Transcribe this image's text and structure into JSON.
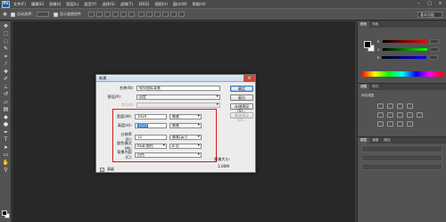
{
  "app": {
    "logo": "Ps"
  },
  "menubar": {
    "items": [
      "文件(F)",
      "编辑(E)",
      "图像(I)",
      "图层(L)",
      "类型(Y)",
      "选择(S)",
      "滤镜(T)",
      "3D(D)",
      "视图(V)",
      "窗口(W)",
      "帮助(H)"
    ]
  },
  "window_controls": {
    "minimize": "–",
    "maximize": "□",
    "close": "×"
  },
  "options_bar": {
    "auto_select": "自动选择：",
    "show_transform": "显示变换控件",
    "workspace": "基本功能"
  },
  "tools": [
    "move-tool",
    "marquee-tool",
    "lasso-tool",
    "quick-select-tool",
    "crop-tool",
    "eyedropper-tool",
    "healing-tool",
    "brush-tool",
    "clone-tool",
    "history-brush-tool",
    "eraser-tool",
    "gradient-tool",
    "blur-tool",
    "dodge-tool",
    "pen-tool",
    "type-tool",
    "path-select-tool",
    "shape-tool",
    "hand-tool",
    "zoom-tool"
  ],
  "panels": {
    "color_tabs": [
      "颜色",
      "色板"
    ],
    "color_sliders": [
      "R",
      "G",
      "B"
    ],
    "adjust_tabs": [
      "调整",
      "样式"
    ],
    "adjust_title": "添加调整",
    "layers_tabs": [
      "图层",
      "通道",
      "路径"
    ]
  },
  "dialog": {
    "title": "新建",
    "close": "×",
    "name_label": "名称(N):",
    "name_value": "钦伴图标背景",
    "preset_label": "预设(P):",
    "preset_value": "自定",
    "size_label": "大小(I):",
    "width_label": "宽度(W):",
    "width_value": "1024",
    "width_unit": "像素",
    "height_label": "高度(H):",
    "height_value": "1024",
    "height_unit": "像素",
    "resolution_label": "分辨率(R):",
    "resolution_value": "72",
    "resolution_unit": "像素/英寸",
    "color_mode_label": "颜色模式(M):",
    "color_mode_value": "RGB 颜色",
    "bit_depth": "8 位",
    "bg_content_label": "背景内容(C):",
    "bg_content_value": "白色",
    "advanced_label": "高级",
    "advanced_toggle": "»",
    "ok_button": "确定",
    "reset_button": "复位",
    "save_preset_button": "存储预设(S)...",
    "delete_preset_button": "删除预设(D)...",
    "image_size_label": "图像大小:",
    "image_size_value": "3.00M"
  },
  "colors": {
    "highlight": "#d61a1a",
    "selection": "#3a78c9"
  }
}
